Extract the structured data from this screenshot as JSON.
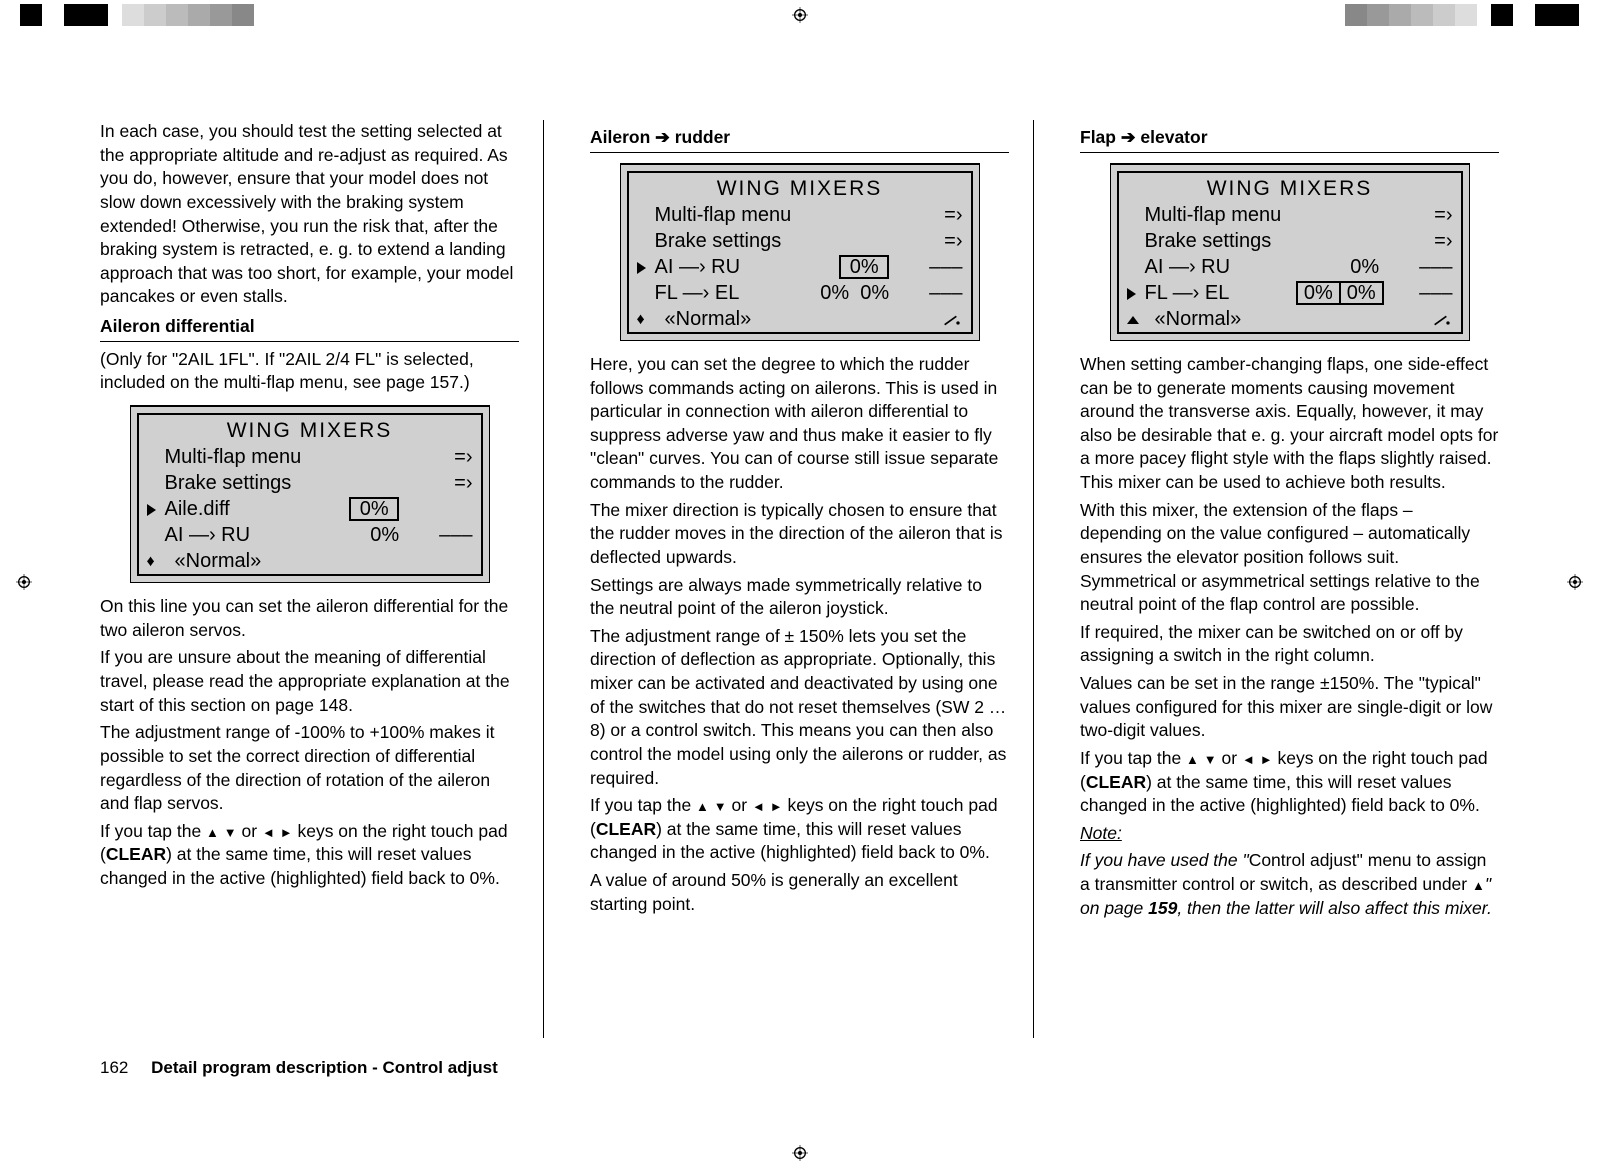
{
  "top_marks": {
    "center_icon": "registration-mark"
  },
  "col1": {
    "p1": "In each case, you should test the setting selected at the appropriate altitude and re-adjust as required. As you do, however, ensure that your model does not slow down excessively with the braking system extended! Otherwise, you run the risk that, after the braking system is retracted, e. g. to extend a landing approach that was too short, for example, your model pancakes or even stalls.",
    "h1": "Aileron differential",
    "p2": "(Only for \"2AIL 1FL\". If \"2AIL 2/4 FL\" is selected, included on the multi-flap menu, see page 157.)",
    "screen": {
      "title": "WING  MIXERS",
      "rows": [
        {
          "label": "Multi-flap menu",
          "go": "=›"
        },
        {
          "label": "Brake settings",
          "go": "=›"
        },
        {
          "cursor": true,
          "label": "Aile.diff",
          "boxed": "0%"
        },
        {
          "label": "AI  —› RU",
          "v1": "0%",
          "v2": "–––"
        },
        {
          "updown": true,
          "label": "«Normal»"
        }
      ]
    },
    "p3": "On this line you can set the aileron differential for the two aileron servos.",
    "p4": "If you are unsure about the meaning of differential travel, please read the appropriate explanation at the start of this section on page 148.",
    "p5": "The adjustment range of -100% to +100% makes it possible to set the correct direction of differential regardless of the direction of rotation of the aileron and flap servos.",
    "p6a": "If you tap the ",
    "p6b": " or ",
    "p6c": " keys on the right touch pad (",
    "p6d": "CLEAR",
    "p6e": ") at the same time, this will reset values changed in the active (highlighted) field back to 0%."
  },
  "col2": {
    "h1a": "Aileron ",
    "h1b": " rudder",
    "screen": {
      "title": "WING  MIXERS",
      "rows": [
        {
          "label": "Multi-flap menu",
          "go": "=›"
        },
        {
          "label": "Brake settings",
          "go": "=›"
        },
        {
          "cursor": true,
          "label": "AI  —› RU",
          "boxed": "0%",
          "v2": "–––"
        },
        {
          "label": "FL  —› EL",
          "v1": "0%",
          "v1b": "0%",
          "v2": "–––"
        },
        {
          "updown": true,
          "label": "«Normal»",
          "sw": true
        }
      ]
    },
    "p1": "Here, you can set the degree to which the rudder follows commands acting on ailerons. This is used in particular in connection with aileron differential to suppress adverse yaw and thus make it easier to fly \"clean\" curves. You can of course still issue separate commands to the rudder.",
    "p2": "The mixer direction is typically chosen to ensure that the rudder moves in the direction of the aileron that is deflected upwards.",
    "p3": "Settings are always made symmetrically relative to the neutral point of the aileron joystick.",
    "p4": "The adjustment range of ± 150% lets you set the direction of deflection as appropriate. Optionally, this mixer can be activated and deactivated by using one of the switches that do not reset themselves (SW 2 … 8) or a control switch. This means you can then also control the model using only the ailerons or rudder, as required.",
    "p5a": "If you tap the ",
    "p5b": " or ",
    "p5c": " keys on the right touch pad (",
    "p5d": "CLEAR",
    "p5e": ") at the same time, this will reset values changed in the active (highlighted) field back to 0%.",
    "p6": "A value of around 50% is generally an excellent starting point."
  },
  "col3": {
    "h1a": "Flap ",
    "h1b": " elevator",
    "screen": {
      "title": "WING  MIXERS",
      "rows": [
        {
          "label": "Multi-flap menu",
          "go": "=›"
        },
        {
          "label": "Brake settings",
          "go": "=›"
        },
        {
          "label": "AI  —› RU",
          "v1": "0%",
          "v2": "–––"
        },
        {
          "cursor": true,
          "label": "FL  —› EL",
          "boxed": "0%",
          "boxed2": "0%",
          "v2": "–––"
        },
        {
          "up": true,
          "label": "«Normal»",
          "sw": true
        }
      ]
    },
    "p1": "When setting camber-changing flaps, one side-effect can be to generate moments causing movement around the transverse axis. Equally, however, it may also be desirable that e. g. your aircraft model opts for a more pacey flight style with the flaps slightly raised. This mixer can be used to achieve both results.",
    "p2": "With this mixer, the extension of the flaps – depending on the value configured – automatically ensures the elevator position follows suit. Symmetrical or asymmetrical settings relative to the neutral point of the flap control are possible.",
    "p3": "If required, the mixer can be switched on or off by assigning a switch in the right column.",
    "p4": "Values can be set in the range ±150%. The \"typical\" values configured for this mixer are single-digit or low two-digit values.",
    "p5a": "If you tap the ",
    "p5b": " or ",
    "p5c": " keys on the right touch pad (",
    "p5d": "CLEAR",
    "p5e": ") at the same time, this will reset values changed in the active (highlighted) field back to 0%.",
    "note_h": "Note:",
    "note_a": "If you have used the \"",
    "note_b": "Control adjust\" menu to assign a transmitter control or switch, as described under ",
    "note_c": "\" on page ",
    "note_d": "159",
    "note_e": ", then the latter will also affect this mixer."
  },
  "footer": {
    "page": "162",
    "title": "Detail program description - Control adjust"
  }
}
